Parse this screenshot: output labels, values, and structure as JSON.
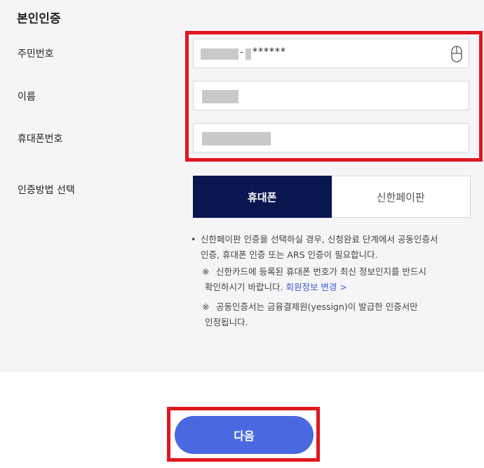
{
  "section_title": "본인인증",
  "labels": {
    "rrn": "주민번호",
    "name": "이름",
    "phone": "휴대폰번호",
    "method": "인증방법 선택"
  },
  "rrn": {
    "separator": "-",
    "masked_back": "******"
  },
  "method_options": {
    "phone": "휴대폰",
    "shinhan_paypan": "신한페이판"
  },
  "notes": {
    "bullet": "•",
    "line1": "신한페이판 인증을 선택하실 경우, 신청완료 단계에서 공동인증서",
    "line2": "인증, 휴대폰 인증 또는 ARS 인증이 필요합니다.",
    "ref_mark": "※",
    "line3": "신한카드에 등록된 휴대폰 번호가 최신 정보인지를 반드시",
    "line4_prefix": "확인하시기 바랍니다.",
    "member_link": "회원정보 변경",
    "link_arrow": ">",
    "line5": "공동인증서는 금융결제원(yessign)이 발급한 인증서만",
    "line6": "인정됩니다."
  },
  "next_button": "다음",
  "colors": {
    "highlight_border": "#e0161f",
    "active_method_bg": "#0a1650",
    "next_button_bg": "#4a68e0",
    "link": "#3c5bd6"
  }
}
